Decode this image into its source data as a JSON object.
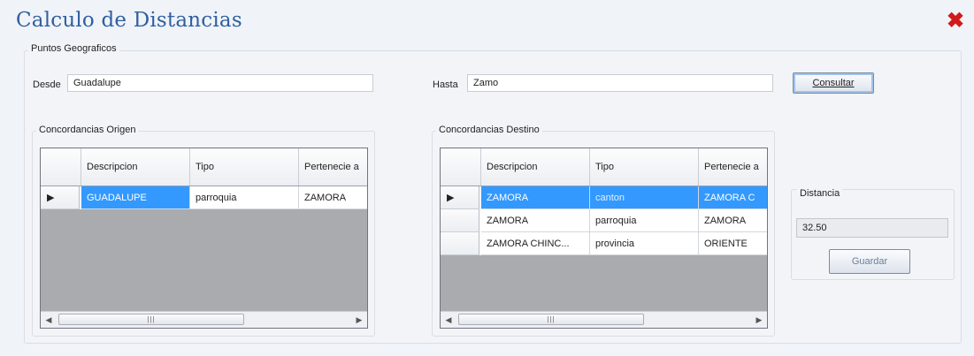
{
  "window": {
    "title": "Calculo de Distancias",
    "close_icon": "close-icon"
  },
  "puntos": {
    "legend": "Puntos Geograficos",
    "desde_label": "Desde",
    "desde_value": "Guadalupe",
    "hasta_label": "Hasta",
    "hasta_value": "Zamo",
    "consultar_label": "Consultar"
  },
  "origen": {
    "legend": "Concordancias Origen",
    "columns": [
      "Descripcion",
      "Tipo",
      "Pertenecie a"
    ],
    "rows": [
      {
        "descripcion": "GUADALUPE",
        "tipo": "parroquia",
        "pertenece": "ZAMORA"
      }
    ]
  },
  "destino": {
    "legend": "Concordancias Destino",
    "columns": [
      "Descripcion",
      "Tipo",
      "Pertenecie a"
    ],
    "rows": [
      {
        "descripcion": "ZAMORA",
        "tipo": "canton",
        "pertenece": "ZAMORA C"
      },
      {
        "descripcion": "ZAMORA",
        "tipo": "parroquia",
        "pertenece": "ZAMORA"
      },
      {
        "descripcion": "ZAMORA CHINC...",
        "tipo": "provincia",
        "pertenece": "ORIENTE"
      }
    ]
  },
  "distancia": {
    "legend": "Distancia",
    "value": "32.50",
    "guardar_label": "Guardar"
  },
  "colors": {
    "title": "#2f5fa0",
    "selection": "#3399ff",
    "close": "#d21a1a"
  }
}
